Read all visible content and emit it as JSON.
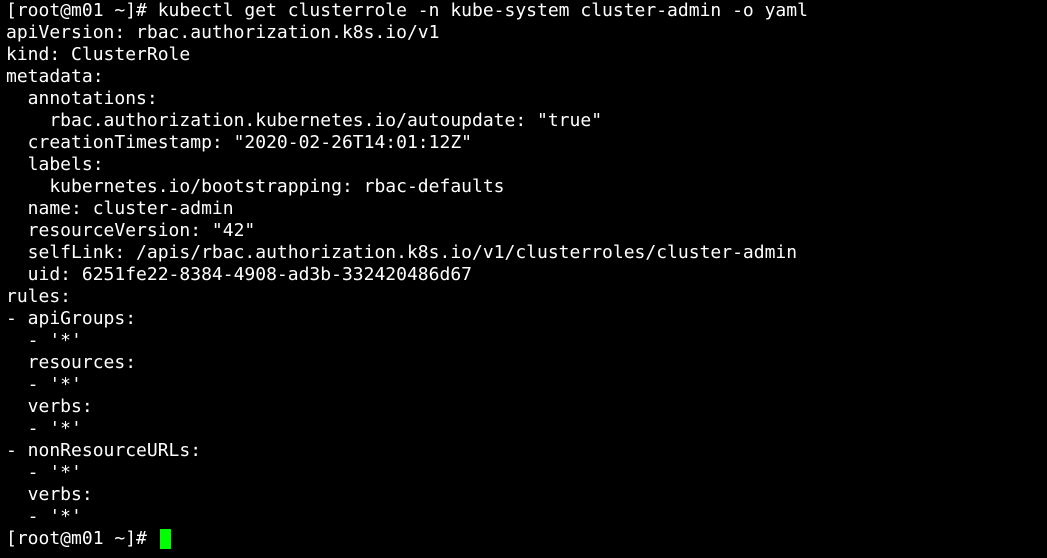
{
  "terminal": {
    "theme": {
      "background": "#000000",
      "foreground": "#ffffff",
      "cursor": "#00ff00"
    },
    "lines": [
      "[root@m01 ~]# kubectl get clusterrole -n kube-system cluster-admin -o yaml",
      "apiVersion: rbac.authorization.k8s.io/v1",
      "kind: ClusterRole",
      "metadata:",
      "  annotations:",
      "    rbac.authorization.kubernetes.io/autoupdate: \"true\"",
      "  creationTimestamp: \"2020-02-26T14:01:12Z\"",
      "  labels:",
      "    kubernetes.io/bootstrapping: rbac-defaults",
      "  name: cluster-admin",
      "  resourceVersion: \"42\"",
      "  selfLink: /apis/rbac.authorization.k8s.io/v1/clusterroles/cluster-admin",
      "  uid: 6251fe22-8384-4908-ad3b-332420486d67",
      "rules:",
      "- apiGroups:",
      "  - '*'",
      "  resources:",
      "  - '*'",
      "  verbs:",
      "  - '*'",
      "- nonResourceURLs:",
      "  - '*'",
      "  verbs:",
      "  - '*'"
    ],
    "prompt": "[root@m01 ~]# "
  }
}
